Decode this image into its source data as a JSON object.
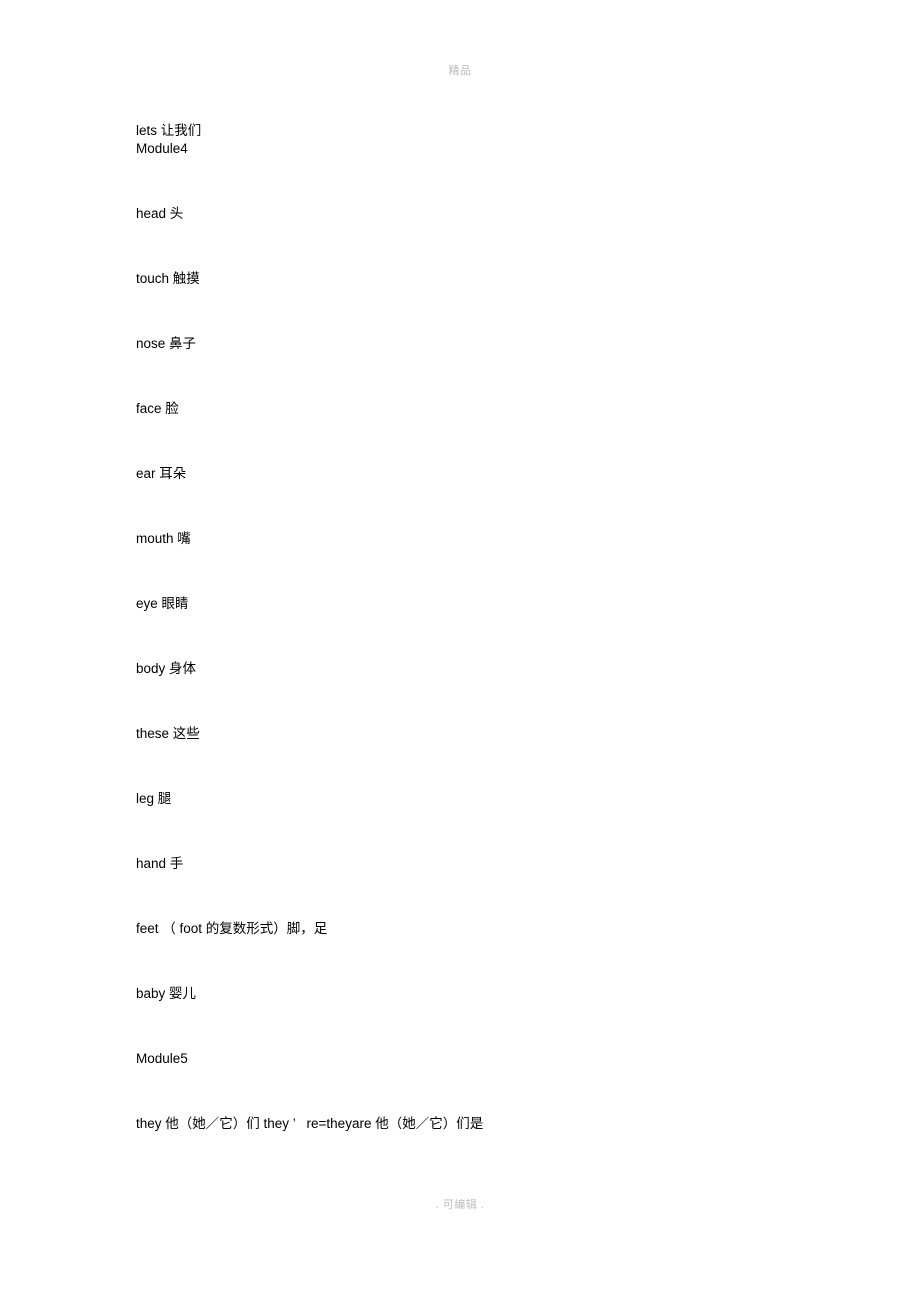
{
  "header": {
    "watermark": "精品"
  },
  "footer": {
    "watermark": ". 可编辑 ."
  },
  "document": {
    "entries": [
      {
        "text": "lets 让我们"
      },
      {
        "text": "Module4"
      },
      {
        "text": "head 头"
      },
      {
        "text": "touch 触摸"
      },
      {
        "text": "nose 鼻子"
      },
      {
        "text": "face 脸"
      },
      {
        "text": "ear 耳朵"
      },
      {
        "text": "mouth 嘴"
      },
      {
        "text": "eye 眼睛"
      },
      {
        "text": "body 身体"
      },
      {
        "text": "these 这些"
      },
      {
        "text": "leg 腿"
      },
      {
        "text": "hand 手"
      },
      {
        "text": "feet （ foot 的复数形式）脚，足"
      },
      {
        "text": "baby 婴儿"
      },
      {
        "text": "Module5"
      },
      {
        "text": "they 他（她／它）们 they ’   re=theyare 他（她／它）们是"
      }
    ]
  }
}
